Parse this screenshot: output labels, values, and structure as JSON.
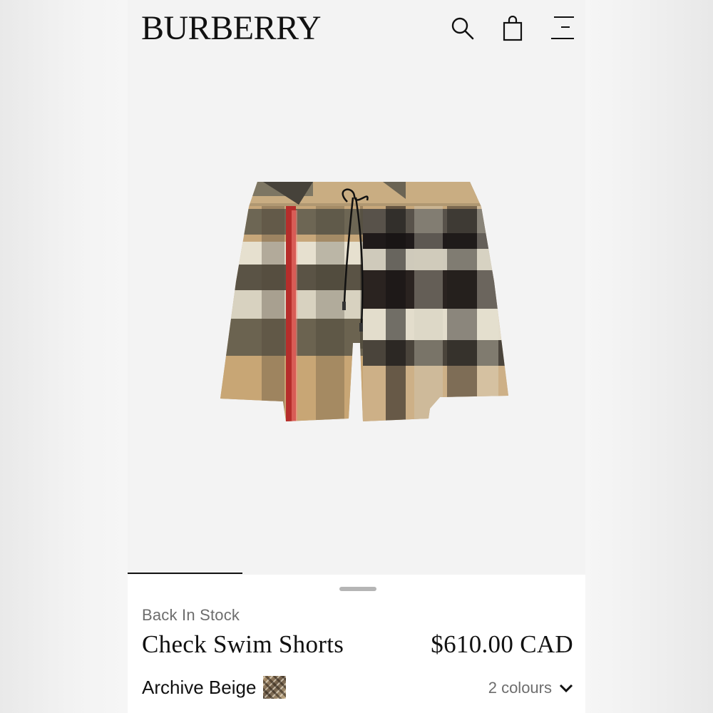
{
  "brand": {
    "logo_text": "BURBERRY"
  },
  "header": {
    "icons": [
      "search-icon",
      "shopping-bag-icon",
      "menu-icon"
    ]
  },
  "carousel": {
    "progress": 0.25
  },
  "product": {
    "stock_status": "Back In Stock",
    "name": "Check Swim Shorts",
    "price": "$610.00 CAD",
    "colour_name": "Archive Beige",
    "colours_label": "2 colours"
  },
  "colors": {
    "background": "#f3f3f3",
    "sheet": "#ffffff",
    "text": "#111111",
    "muted": "#6d6d6d"
  }
}
